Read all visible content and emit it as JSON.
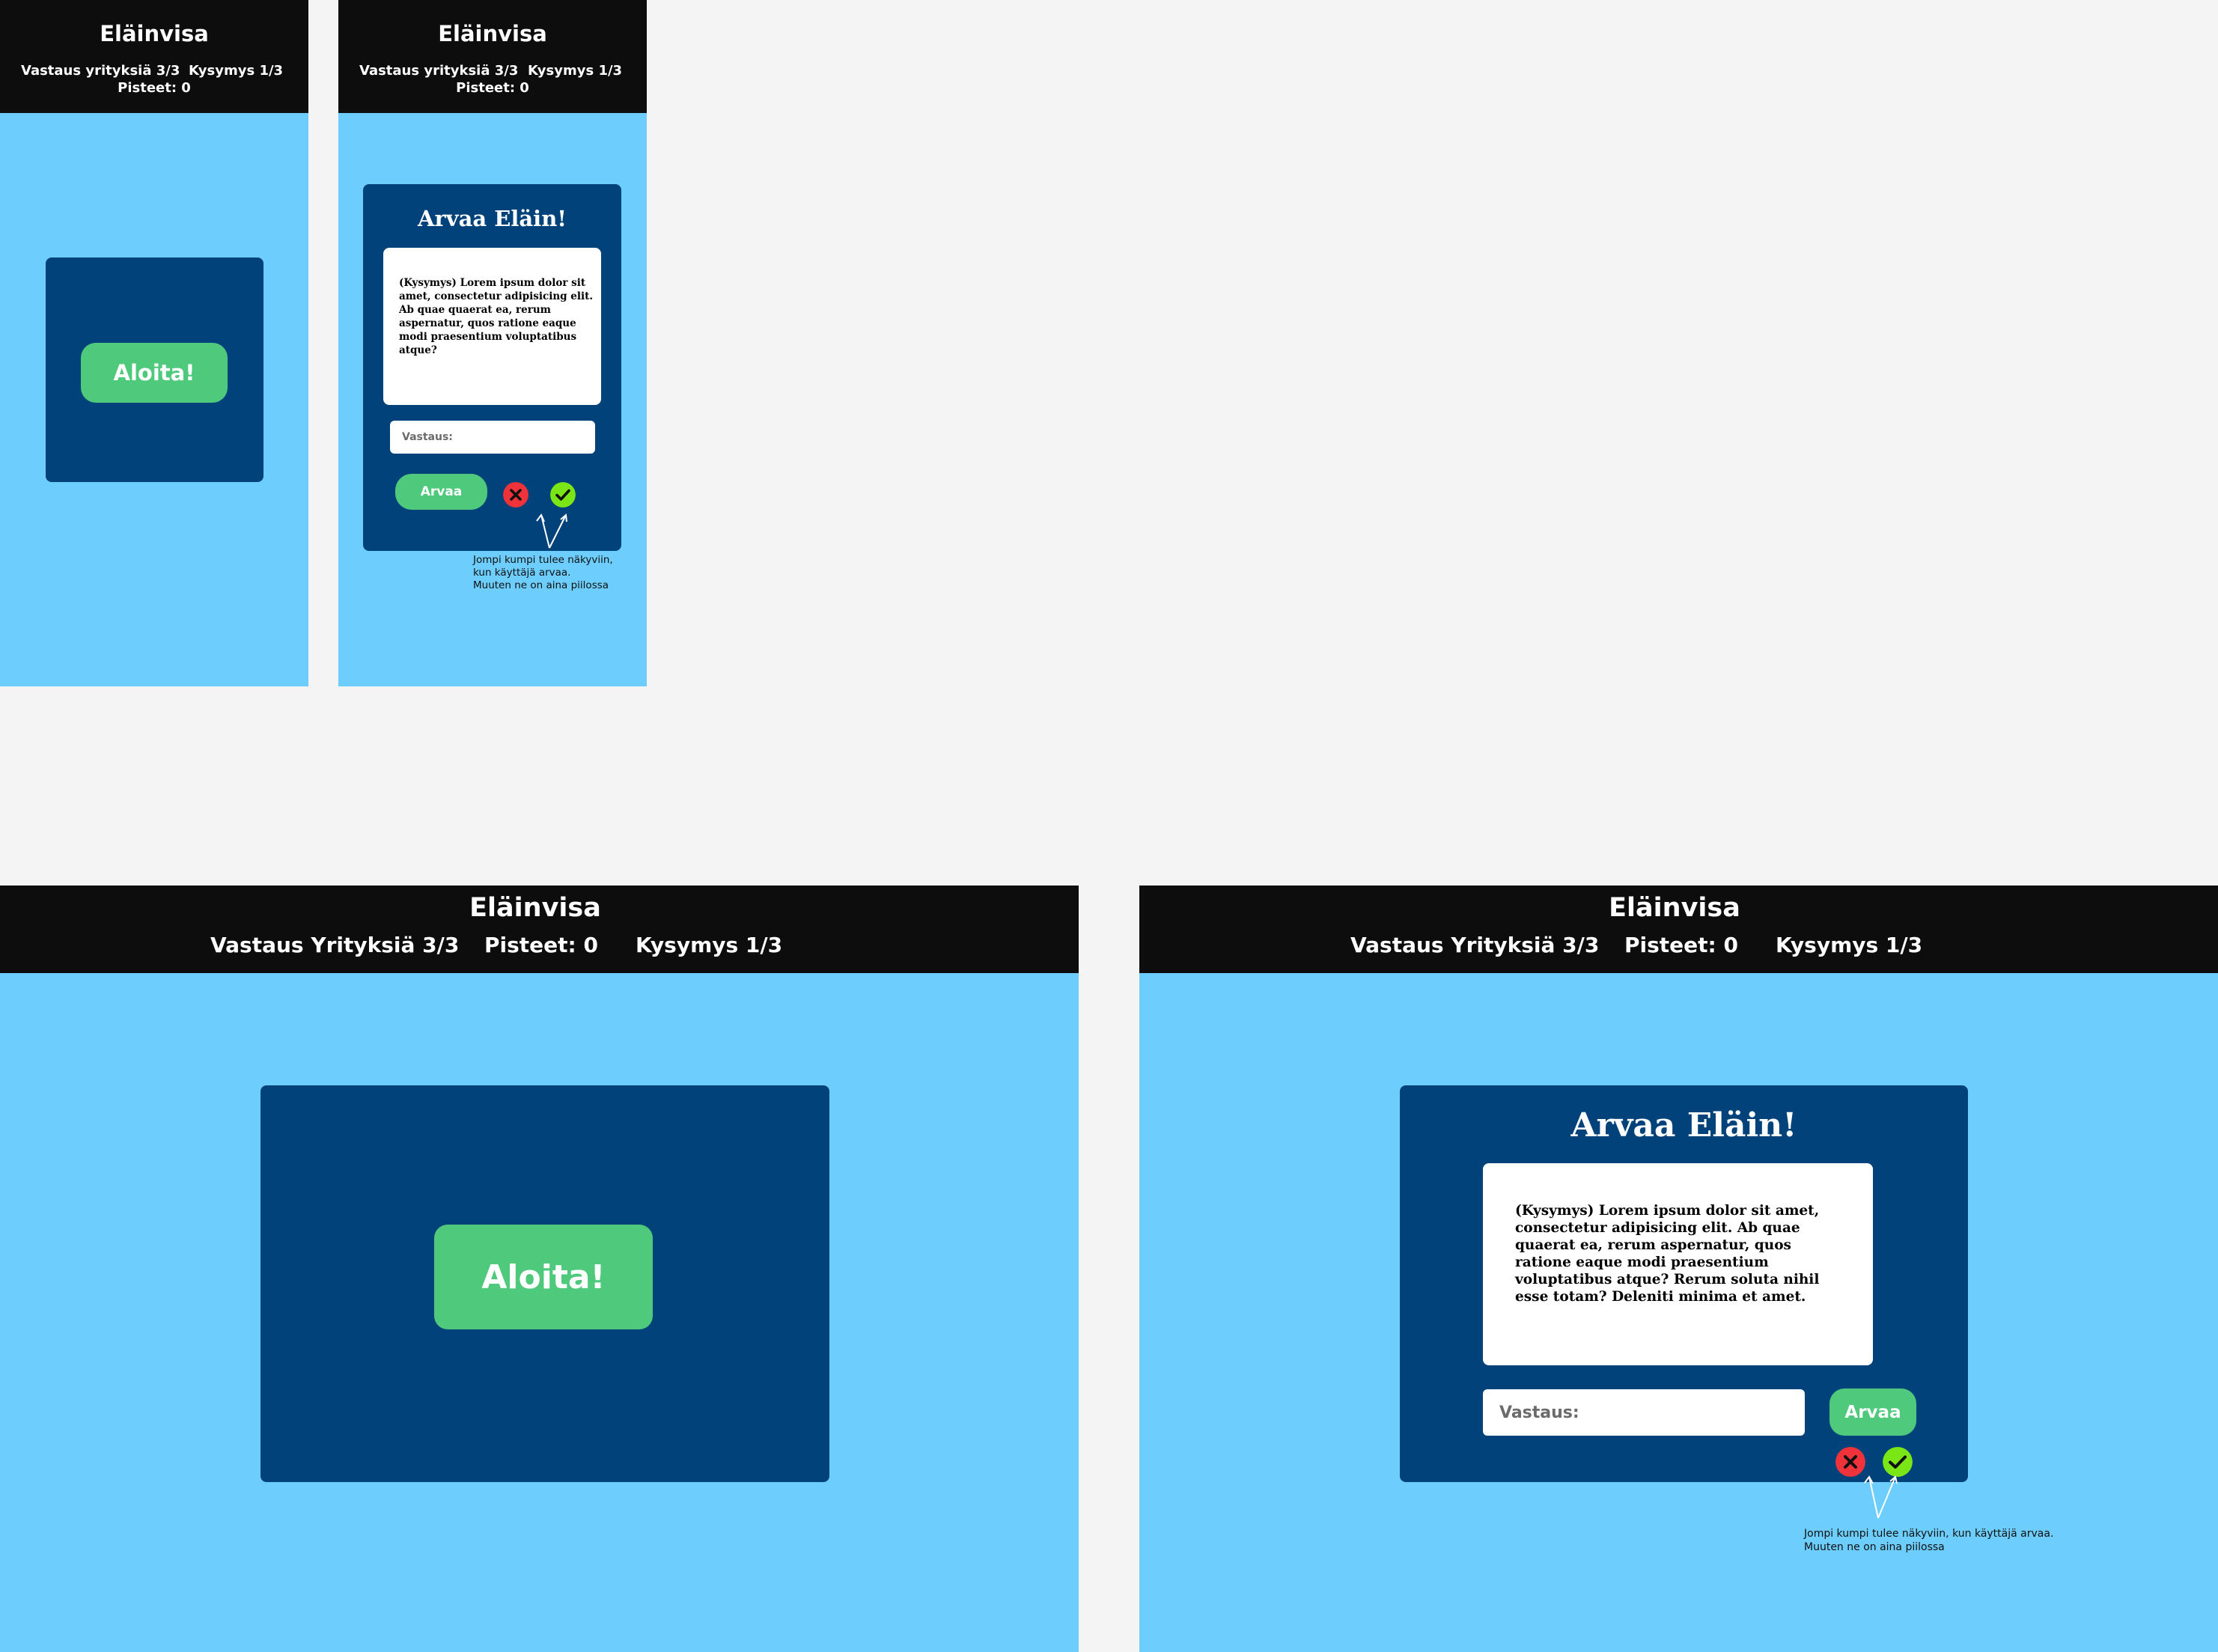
{
  "app_title": "Eläinvisa",
  "mobile": {
    "attempts": "Vastaus yrityksiä 3/3",
    "question_counter": "Kysymys 1/3",
    "score": "Pisteet: 0"
  },
  "desktop": {
    "attempts": "Vastaus Yrityksiä 3/3",
    "score": "Pisteet: 0",
    "question_counter": "Kysymys 1/3"
  },
  "start_button": "Aloita!",
  "quiz": {
    "heading": "Arvaa Eläin!",
    "question_mobile": "(Kysymys) Lorem ipsum dolor sit amet, consectetur adipisicing elit. Ab quae quaerat ea, rerum aspernatur, quos ratione eaque modi praesentium voluptatibus atque?",
    "question_desktop": "(Kysymys) Lorem ipsum dolor sit amet, consectetur adipisicing elit. Ab quae quaerat ea, rerum aspernatur, quos ratione eaque modi praesentium voluptatibus atque? Rerum soluta nihil esse totam? Deleniti minima et amet.",
    "answer_placeholder": "Vastaus:",
    "guess_button": "Arvaa"
  },
  "annotation": {
    "mobile_line1": "Jompi kumpi tulee näkyviin,",
    "mobile_line2": "kun käyttäjä arvaa.",
    "mobile_line3": "Muuten ne on aina piilossa",
    "desktop_line1": "Jompi kumpi tulee näkyviin, kun käyttäjä arvaa.",
    "desktop_line2": "Muuten ne on aina piilossa"
  },
  "icons": {
    "wrong": "close-icon",
    "correct": "check-icon"
  },
  "colors": {
    "background": "#6dcdfc",
    "header": "#0d0d0d",
    "card": "#01427b",
    "button": "#4fc97b",
    "wrong": "#f0333b",
    "correct": "#7be615"
  }
}
